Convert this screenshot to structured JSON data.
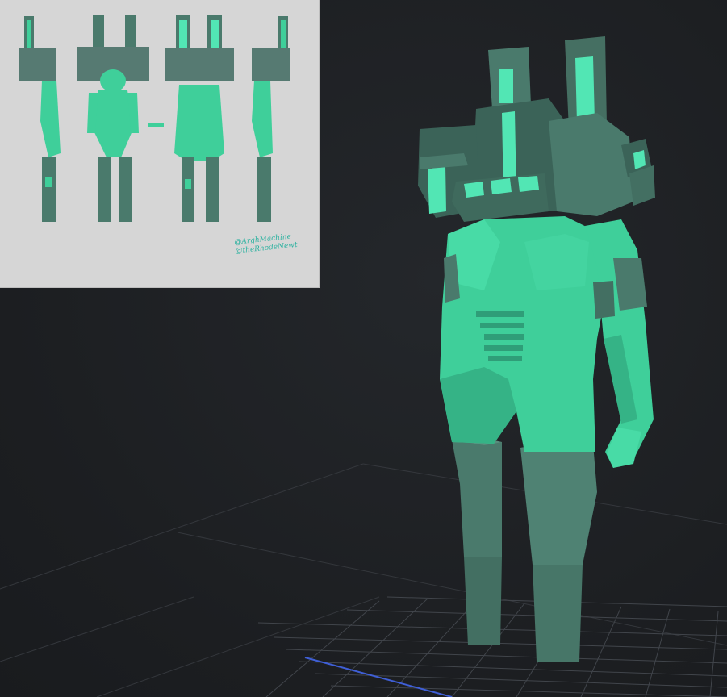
{
  "viewport": {
    "background_color": "#1d1f22",
    "grid_color": "#3a3d42",
    "axis_color": "#3f5fd6"
  },
  "model": {
    "armor_color": "#4a7a6c",
    "armor_dark_color": "#3b6358",
    "body_color": "#3fcf9a",
    "body_shade_color": "#35b386",
    "glow_color": "#52e6b4"
  },
  "reference_image": {
    "background_color": "#d6d6d6",
    "signature_lines": [
      "@ArghMachine",
      "@theRhodeNewt"
    ]
  }
}
